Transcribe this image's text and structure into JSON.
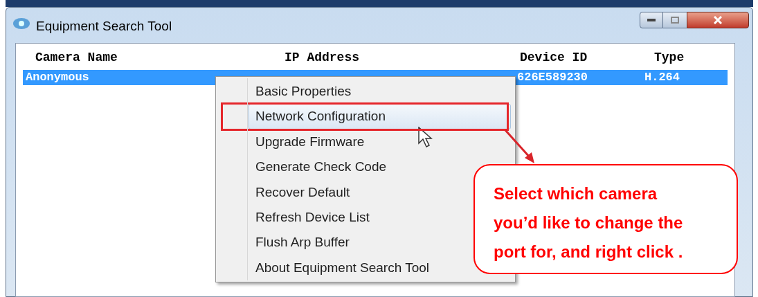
{
  "window": {
    "title": "Equipment Search Tool"
  },
  "table": {
    "columns": [
      "Camera Name",
      "IP Address",
      "Device ID",
      "Type"
    ],
    "rows": [
      {
        "cells": [
          "Anonymous",
          "",
          "626E589230",
          "H.264"
        ],
        "selected": true
      }
    ]
  },
  "context_menu": {
    "items": [
      {
        "label": "Basic Properties",
        "selected": false
      },
      {
        "label": "Network Configuration",
        "selected": true
      },
      {
        "label": "Upgrade Firmware",
        "selected": false
      },
      {
        "label": "Generate Check Code",
        "selected": false
      },
      {
        "label": "Recover Default",
        "selected": false
      },
      {
        "label": "Refresh Device List",
        "selected": false
      },
      {
        "label": "Flush Arp Buffer",
        "selected": false
      },
      {
        "label": "About Equipment Search Tool",
        "selected": false
      }
    ]
  },
  "callout": {
    "text": "Select which camera you’d like to change the port for, and right click ."
  }
}
